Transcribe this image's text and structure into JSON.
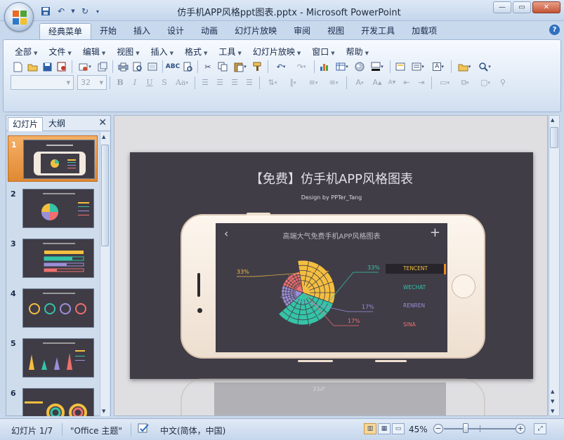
{
  "window": {
    "title": "仿手机APP风格ppt图表.pptx - Microsoft PowerPoint",
    "controls": [
      "—",
      "▭",
      "✕"
    ]
  },
  "quick_access": [
    "save-icon",
    "undo-icon",
    "redo-icon",
    "customize-icon"
  ],
  "ribbon_tabs": [
    "经典菜单",
    "开始",
    "插入",
    "设计",
    "动画",
    "幻灯片放映",
    "审阅",
    "视图",
    "开发工具",
    "加载项"
  ],
  "active_tab": "经典菜单",
  "classic_menu": [
    "全部",
    "文件",
    "编辑",
    "视图",
    "插入",
    "格式",
    "工具",
    "幻灯片放映",
    "窗口",
    "帮助"
  ],
  "font_size_box": "32",
  "pane_tabs": {
    "slides": "幻灯片",
    "outline": "大纲",
    "close": "✕"
  },
  "slide_numbers": [
    "1",
    "2",
    "3",
    "4",
    "5",
    "6"
  ],
  "slide": {
    "title": "【免费】仿手机APP风格图表",
    "subtitle": "Design by PPTer_Tang",
    "phone_title": "高端大气免费手机APP风格图表",
    "back_glyph": "‹",
    "plus_glyph": "+",
    "percent_labels": [
      "33%",
      "33%",
      "17%",
      "17%"
    ],
    "legend": [
      "TENCENT",
      "WECHAT",
      "RENREN",
      "SINA"
    ],
    "reflect_text": "33%"
  },
  "chart_data": {
    "type": "pie",
    "categories": [
      "TENCENT",
      "WECHAT",
      "RENREN",
      "SINA"
    ],
    "values": [
      33,
      33,
      17,
      17
    ],
    "colors": [
      "#f5be3f",
      "#35c4a7",
      "#9b8fd8",
      "#ef6f6f"
    ],
    "labels": [
      "33%",
      "33%",
      "17%",
      "17%"
    ]
  },
  "status": {
    "slide_pos": "幻灯片 1/7",
    "theme": "\"Office 主题\"",
    "language": "中文(简体，中国)",
    "zoom": "45%",
    "zoom_fraction": 0.3
  },
  "colors": {
    "accent": "#f08a24",
    "ribbon": "#dde8f5",
    "slide_bg": "#403d47"
  }
}
